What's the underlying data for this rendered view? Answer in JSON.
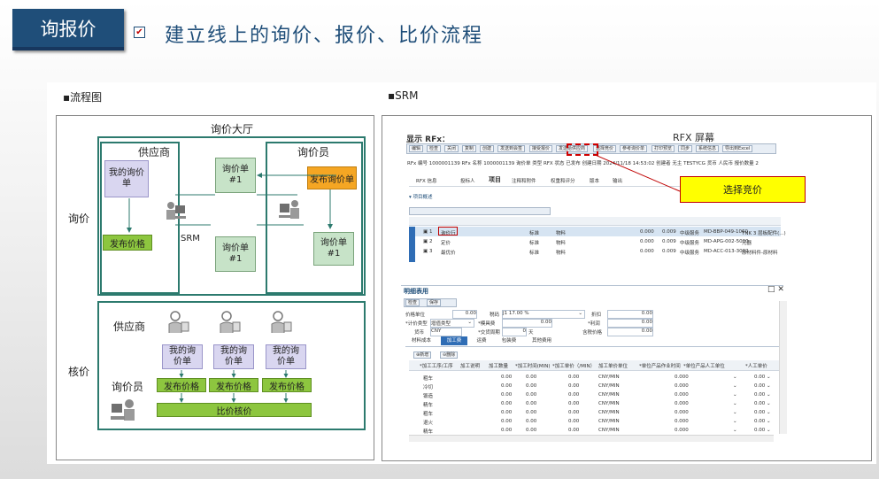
{
  "header": {
    "badge": "询报价",
    "title": "建立线上的询价、报价、比价流程",
    "check_mark": "✔"
  },
  "left": {
    "label": "▪流程图",
    "hall_title": "询价大厅",
    "side_inquiry": "询价",
    "side_check": "核价",
    "supplier": "供应商",
    "inquirer": "询价员",
    "my_inquiry": "我的询价单",
    "inquiry_sheet": "询价单\n#1",
    "publish_inquiry": "发布询价单",
    "publish_price": "发布价格",
    "srm": "SRM",
    "supplier2": "供应商",
    "inquirer2": "询价员",
    "my_inquiry_2": "我的询价单",
    "compare": "比价核价"
  },
  "right": {
    "label": "▪SRM",
    "rfx_title": "显示 RFx：",
    "rfx_screen": "RFX 屏幕",
    "callout": "选择竞价",
    "toolbar": [
      "编辑",
      "检查",
      "关闭",
      "复制",
      "创建",
      "发送到会签",
      "接受报价",
      "发送给供应商",
      "选择竞价",
      "参考询价单",
      "打印预览",
      "同步",
      "系统信息",
      "导出到Excel"
    ],
    "info_line": "RFx 编号 1000001139   RFx 名称 1000001139 询价单   类型 RFX   状态 已发布   创建日期 2024/11/18 14:53:02   创建者 无主 TESTYCG   货币 人民币   报价数量 2",
    "tabs": [
      "RFX 信息",
      "投标人",
      "项目",
      "注释和附件",
      "权重和评分",
      "版本",
      "输出"
    ],
    "active_tab": "项目",
    "detail_title": "明细表用",
    "sub_tabs": [
      "材料成本",
      "加工费",
      "运费",
      "包装费",
      "其他费用"
    ],
    "active_sub_tab": "加工费",
    "fields": {
      "price_unit_label": "价格单位",
      "price_unit": "0.00",
      "tax_label": "税码",
      "tax": "J1 17.00 %",
      "discount_label": "折扣",
      "discount": "0.00",
      "calc_label": "*计价类型",
      "calc": "增值类型",
      "tooling_label": "*模具费",
      "tooling": "0.00",
      "profit_label": "*利润",
      "profit": "0.00",
      "currency_label": "货币",
      "currency": "CNY",
      "lead_label": "*交货周期",
      "lead": "0",
      "lead_unit": "天",
      "total_label": "含税价格",
      "total": "0.00"
    },
    "grid_header": [
      "*加工工序/工序",
      "加工说明",
      "加工数量",
      "*加工时间(MIN)",
      "*加工单价（/MIN）",
      "加工单价单位",
      "*单位产品作业时间",
      "*单位产品人工单位",
      "*人工单价"
    ],
    "grid_rows": [
      {
        "name": "粗车",
        "qty": "0.00",
        "time": "0.00",
        "price": "0.00",
        "unit": "CNY/MIN",
        "work": "0.000",
        "labor": "0.00"
      },
      {
        "name": "冷切",
        "qty": "0.00",
        "time": "0.00",
        "price": "0.00",
        "unit": "CNY/MIN",
        "work": "0.000",
        "labor": "0.00"
      },
      {
        "name": "锻造",
        "qty": "0.00",
        "time": "0.00",
        "price": "0.00",
        "unit": "CNY/MIN",
        "work": "0.000",
        "labor": "0.00"
      },
      {
        "name": "精车",
        "qty": "0.00",
        "time": "0.00",
        "price": "0.00",
        "unit": "CNY/MIN",
        "work": "0.000",
        "labor": "0.00"
      },
      {
        "name": "粗车",
        "qty": "0.00",
        "time": "0.00",
        "price": "0.00",
        "unit": "CNY/MIN",
        "work": "0.000",
        "labor": "0.00"
      },
      {
        "name": "退火",
        "qty": "0.00",
        "time": "0.00",
        "price": "0.00",
        "unit": "CNY/MIN",
        "work": "0.000",
        "labor": "0.00"
      },
      {
        "name": "精车",
        "qty": "0.00",
        "time": "0.00",
        "price": "0.00",
        "unit": "CNY/MIN",
        "work": "0.000",
        "labor": "0.00"
      }
    ],
    "item_rows": [
      {
        "no": "1",
        "type": "询价行",
        "tax": "标准",
        "mat": "物料",
        "v1": "0.000",
        "v2": "0.009",
        "cat": "中级服务",
        "code": "MD-BBP-049-1060",
        "desc": "TNK 3 层板配件(...)"
      },
      {
        "no": "2",
        "type": "定价",
        "tax": "标准",
        "mat": "物料",
        "v1": "0.000",
        "v2": "0.009",
        "cat": "中级服务",
        "code": "MD-APG-002-5000",
        "desc": "元器"
      },
      {
        "no": "3",
        "type": "最优价",
        "tax": "标准",
        "mat": "物料",
        "v1": "0.000",
        "v2": "0.009",
        "cat": "中级服务",
        "code": "MD-ACC-013-3002",
        "desc": "原材料件-原材料"
      }
    ],
    "grid_buttons": [
      "新增",
      "删除"
    ],
    "detail_buttons": [
      "检查",
      "保存"
    ]
  }
}
